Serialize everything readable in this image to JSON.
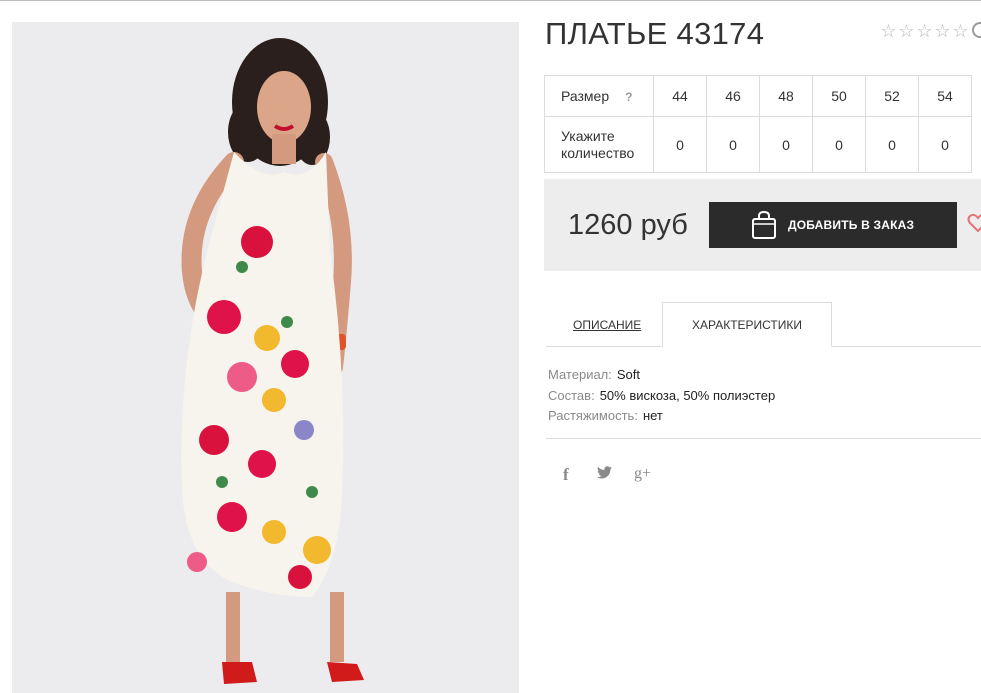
{
  "product": {
    "title": "ПЛАТЬЕ 43174",
    "rating": {
      "stars_total": 5,
      "stars_filled": 0
    }
  },
  "size_table": {
    "size_label": "Размер",
    "help_mark": "?",
    "sizes": [
      "44",
      "46",
      "48",
      "50",
      "52",
      "54"
    ],
    "qty_label": "Укажите количество",
    "quantities": [
      "0",
      "0",
      "0",
      "0",
      "0",
      "0"
    ]
  },
  "purchase": {
    "price": "1260 руб",
    "add_button_label": "ДОБАВИТЬ В ЗАКАЗ"
  },
  "tabs": {
    "description": "ОПИСАНИЕ",
    "characteristics": "ХАРАКТЕРИСТИКИ",
    "active": "characteristics"
  },
  "characteristics": [
    {
      "key": "Материал:",
      "value": "Soft"
    },
    {
      "key": "Состав:",
      "value": "50% вискоза, 50% полиэстер"
    },
    {
      "key": "Растяжимость:",
      "value": "нет"
    }
  ],
  "social": {
    "facebook": "f",
    "twitter": "t",
    "googleplus": "g+"
  },
  "icons": {
    "star": "star-outline-icon",
    "bag": "shopping-bag-icon",
    "heart": "heart-icon",
    "compare": "compare-icon"
  },
  "colors": {
    "button_bg": "#2b2b2b",
    "price_panel_bg": "#ededed",
    "heart": "#e57373",
    "dress_accent": "#e5194b"
  }
}
